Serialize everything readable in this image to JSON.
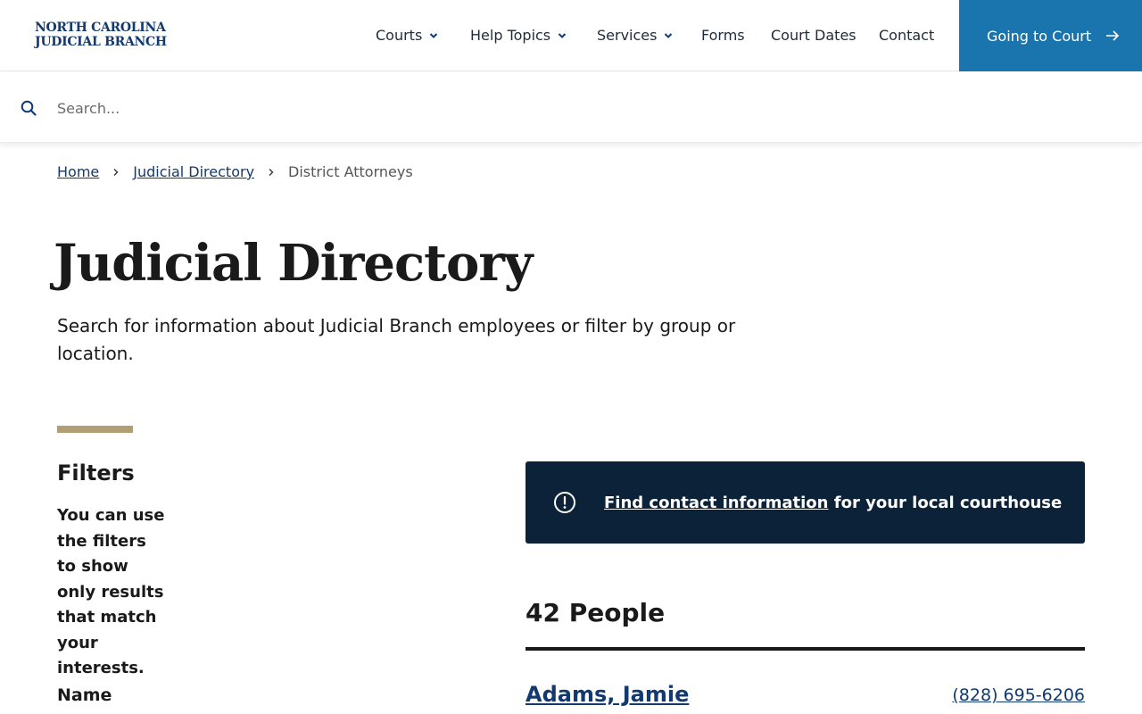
{
  "header": {
    "logo_line1": "NORTH CAROLINA",
    "logo_line2": "JUDICIAL BRANCH",
    "nav": [
      {
        "label": "Courts",
        "has_dropdown": true
      },
      {
        "label": "Help Topics",
        "has_dropdown": true
      },
      {
        "label": "Services",
        "has_dropdown": true
      },
      {
        "label": "Forms",
        "has_dropdown": false
      },
      {
        "label": "Court Dates",
        "has_dropdown": false
      },
      {
        "label": "Contact",
        "has_dropdown": false
      }
    ],
    "cta_label": "Going to Court"
  },
  "search": {
    "placeholder": "Search...",
    "value": ""
  },
  "breadcrumb": {
    "home": "Home",
    "directory": "Judicial Directory",
    "current": "District Attorneys"
  },
  "page": {
    "title": "Judicial Directory",
    "intro": "Search for information about Judicial Branch employees or filter by group or location."
  },
  "filters": {
    "title": "Filters",
    "description": "You can use the filters to show only results that match your interests.",
    "name_label": "Name"
  },
  "alert": {
    "link_text": "Find contact information",
    "rest_text": " for your local courthouse"
  },
  "results": {
    "count_label": "42 People",
    "people": [
      {
        "name": "Adams, Jamie",
        "phone": "(828) 695-6206"
      }
    ]
  },
  "colors": {
    "brand_navy": "#123a70",
    "cta_blue": "#1a75ae",
    "alert_bg": "#0c2238",
    "accent_gold": "#b29e74"
  },
  "icons": {
    "search": "search-icon",
    "chevron": "chevron-down-icon",
    "arrow": "arrow-right-icon",
    "alert": "exclamation-circle-icon",
    "breadcrumb_sep": "chevron-right-icon"
  }
}
